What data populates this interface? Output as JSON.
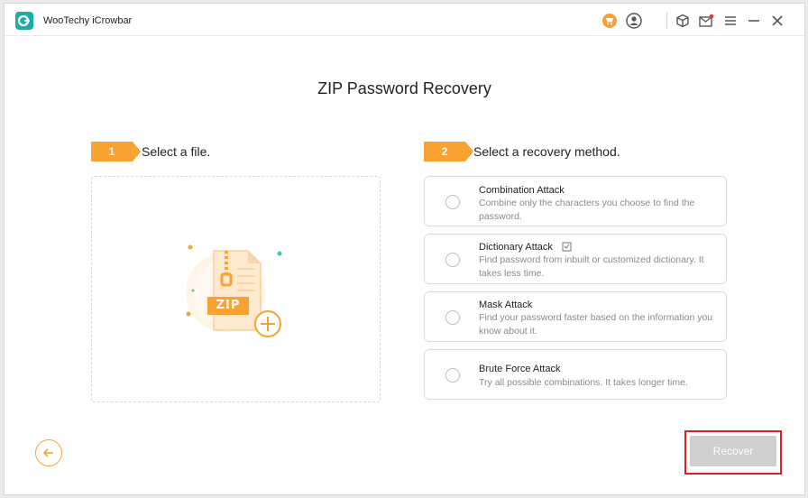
{
  "app": {
    "title": "WooTechy iCrowbar",
    "accent": "#f7a232",
    "logo_color": "#1aaea5"
  },
  "titlebar": {
    "icons": [
      "cart-icon",
      "account-icon",
      "cube-icon",
      "mail-icon",
      "menu-icon",
      "minimize-icon",
      "close-icon"
    ]
  },
  "page": {
    "title": "ZIP Password Recovery"
  },
  "step1": {
    "number": "1",
    "label": "Select a file.",
    "file_badge": "ZIP"
  },
  "step2": {
    "number": "2",
    "label": "Select a recovery method.",
    "methods": [
      {
        "title": "Combination Attack",
        "desc": "Combine only the characters you choose to find the password."
      },
      {
        "title": "Dictionary Attack",
        "desc": "Find password from inbuilt or customized dictionary. It takes less time."
      },
      {
        "title": "Mask Attack",
        "desc": "Find your password faster based on the information you know about it."
      },
      {
        "title": "Brute Force Attack",
        "desc": "Try all possible combinations. It takes longer time."
      }
    ]
  },
  "footer": {
    "recover_label": "Recover"
  }
}
